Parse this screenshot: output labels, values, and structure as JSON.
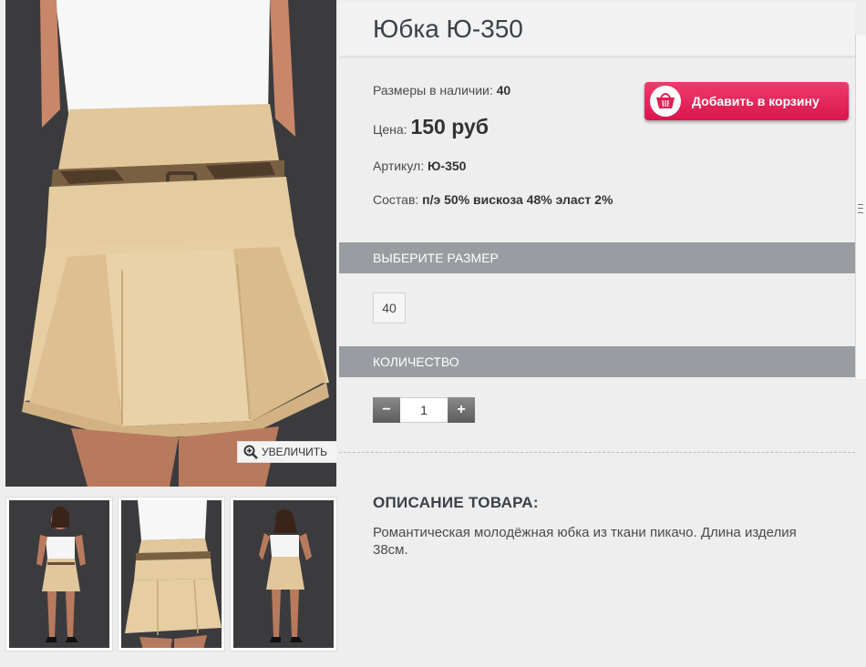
{
  "product": {
    "title": "Юбка Ю-350",
    "sizes_label": "Размеры в наличии:",
    "sizes_value": "40",
    "price_label": "Цена:",
    "price_value": "150 руб",
    "article_label": "Артикул:",
    "article_value": "Ю-350",
    "composition_label": "Состав:",
    "composition_value": "п/э 50% вискоза 48% эласт 2%"
  },
  "gallery": {
    "zoom_label": "УВЕЛИЧИТЬ",
    "thumbnail_count": 3
  },
  "cart_button": {
    "label": "Добавить в корзину"
  },
  "size_section": {
    "title": "ВЫБЕРИТЕ РАЗМЕР",
    "options": [
      "40"
    ]
  },
  "quantity_section": {
    "title": "КОЛИЧЕСТВО",
    "minus": "−",
    "value": "1",
    "plus": "+"
  },
  "description": {
    "title": "ОПИСАНИЕ ТОВАРА:",
    "text": "Романтическая молодёжная юбка из ткани пикачо. Длина изделия 38см."
  },
  "colors": {
    "accent": "#e01f55",
    "section_bar": "#999ca1",
    "skirt": "#e2c79b",
    "background": "#eeeeee"
  }
}
